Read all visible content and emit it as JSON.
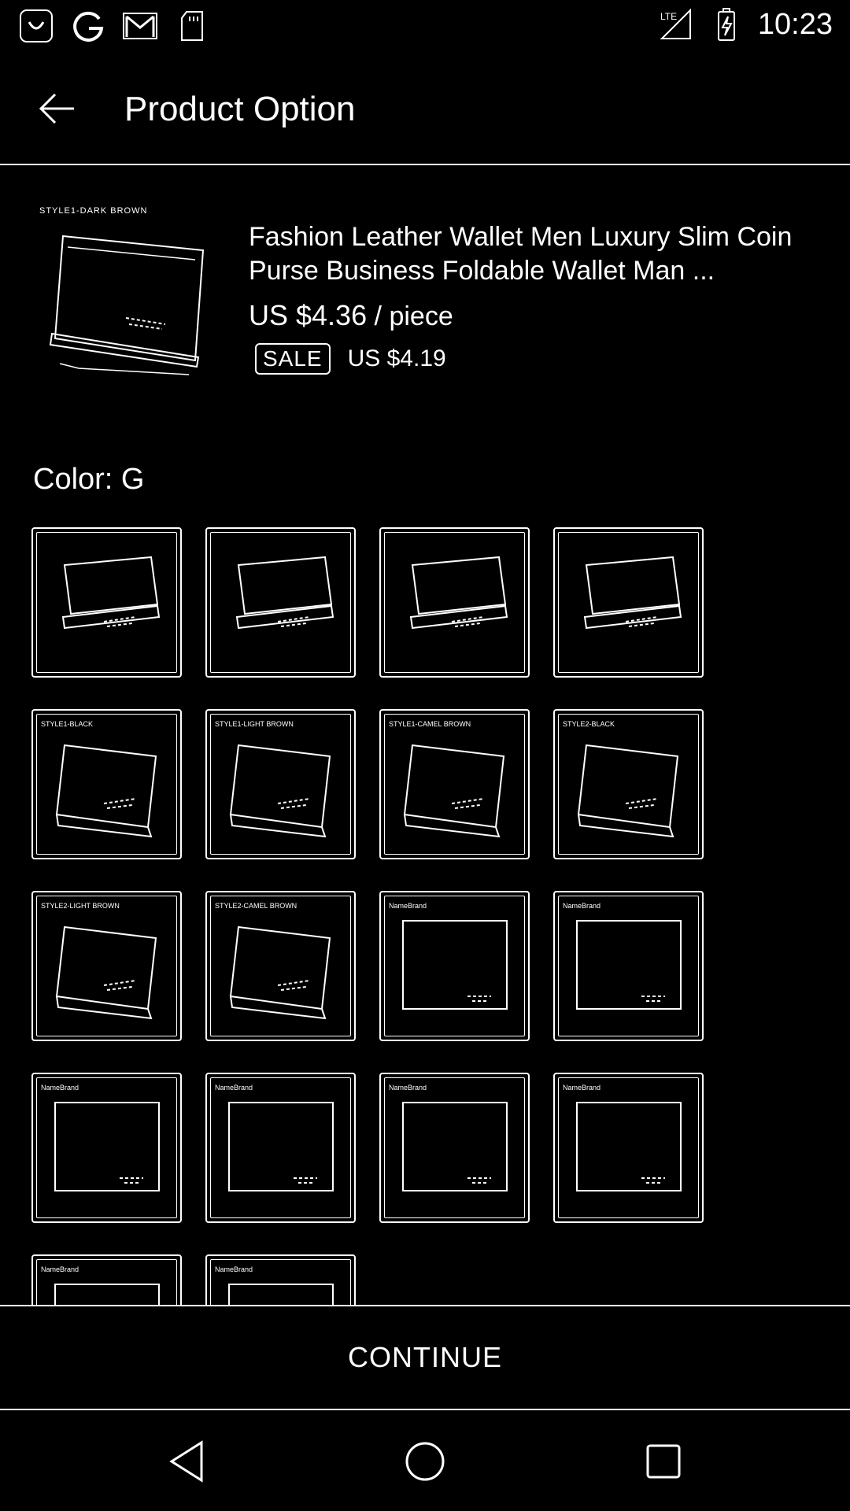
{
  "status_bar": {
    "time": "10:23",
    "left_icons": [
      "shopping-bag-icon",
      "google-icon",
      "gmail-icon",
      "sd-card-icon"
    ],
    "right_icons": [
      "lte-signal-icon",
      "battery-charging-icon"
    ]
  },
  "app_bar": {
    "title": "Product Option",
    "back_icon": "arrow-left-icon"
  },
  "product": {
    "thumbnail_caption": "STYLE1-DARK BROWN",
    "title": "Fashion Leather Wallet Men Luxury Slim Coin Purse Business Foldable Wallet Man ...",
    "price": "US $4.36",
    "price_unit": " / piece",
    "sale_badge": "SALE",
    "sale_price": "US $4.19"
  },
  "color": {
    "label": "Color: G",
    "options_count_visible": 18,
    "option_captions": [
      "",
      "",
      "",
      "",
      "STYLE1-BLACK",
      "STYLE1-LIGHT BROWN",
      "STYLE1-CAMEL BROWN",
      "STYLE2-BLACK",
      "STYLE2-LIGHT BROWN",
      "STYLE2-CAMEL BROWN",
      "NameBrand",
      "NameBrand",
      "NameBrand",
      "NameBrand",
      "NameBrand",
      "NameBrand",
      "NameBrand",
      "NameBrand"
    ]
  },
  "continue_button": "CONTINUE",
  "nav_bar": {
    "back_icon": "nav-back-triangle-icon",
    "home_icon": "nav-home-circle-icon",
    "recents_icon": "nav-recents-square-icon"
  }
}
